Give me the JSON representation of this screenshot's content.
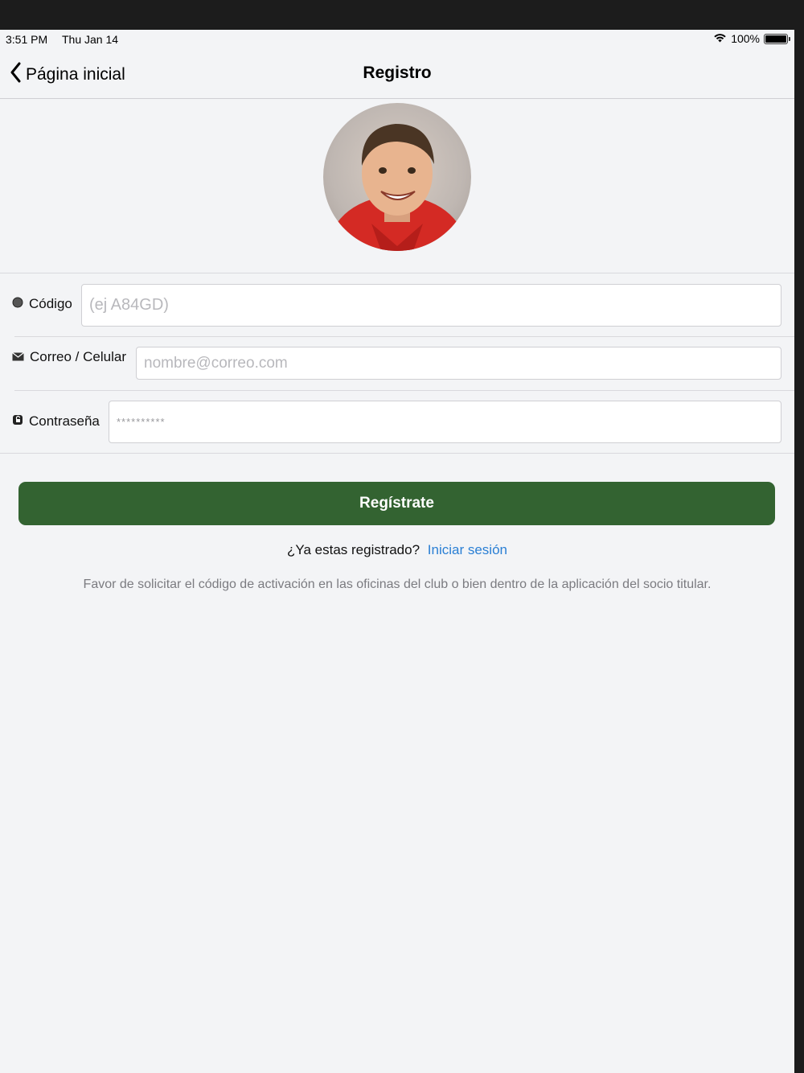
{
  "status_bar": {
    "time": "3:51 PM",
    "date": "Thu Jan 14",
    "battery": "100%"
  },
  "nav": {
    "back_label": "Página inicial",
    "title": "Registro"
  },
  "form": {
    "codigo": {
      "label": "Código",
      "placeholder": "(ej A84GD)",
      "value": ""
    },
    "correo": {
      "label": "Correo / Celular",
      "placeholder": "nombre@correo.com",
      "value": ""
    },
    "password": {
      "label": "Contraseña",
      "placeholder": "**********",
      "value": ""
    }
  },
  "register_button": "Regístrate",
  "already_registered": {
    "question": "¿Ya estas registrado?",
    "link": "Iniciar sesión"
  },
  "info_text": "Favor de solicitar el código de activación en las oficinas del club o bien dentro de la aplicación del socio titular.",
  "colors": {
    "primary_button": "#336331",
    "link": "#2a7fd4",
    "background": "#f3f4f6"
  },
  "icons": {
    "codigo": "circle-icon",
    "correo": "envelope-icon",
    "password": "lock-icon",
    "back": "chevron-left-icon",
    "wifi": "wifi-icon",
    "battery": "battery-icon"
  }
}
